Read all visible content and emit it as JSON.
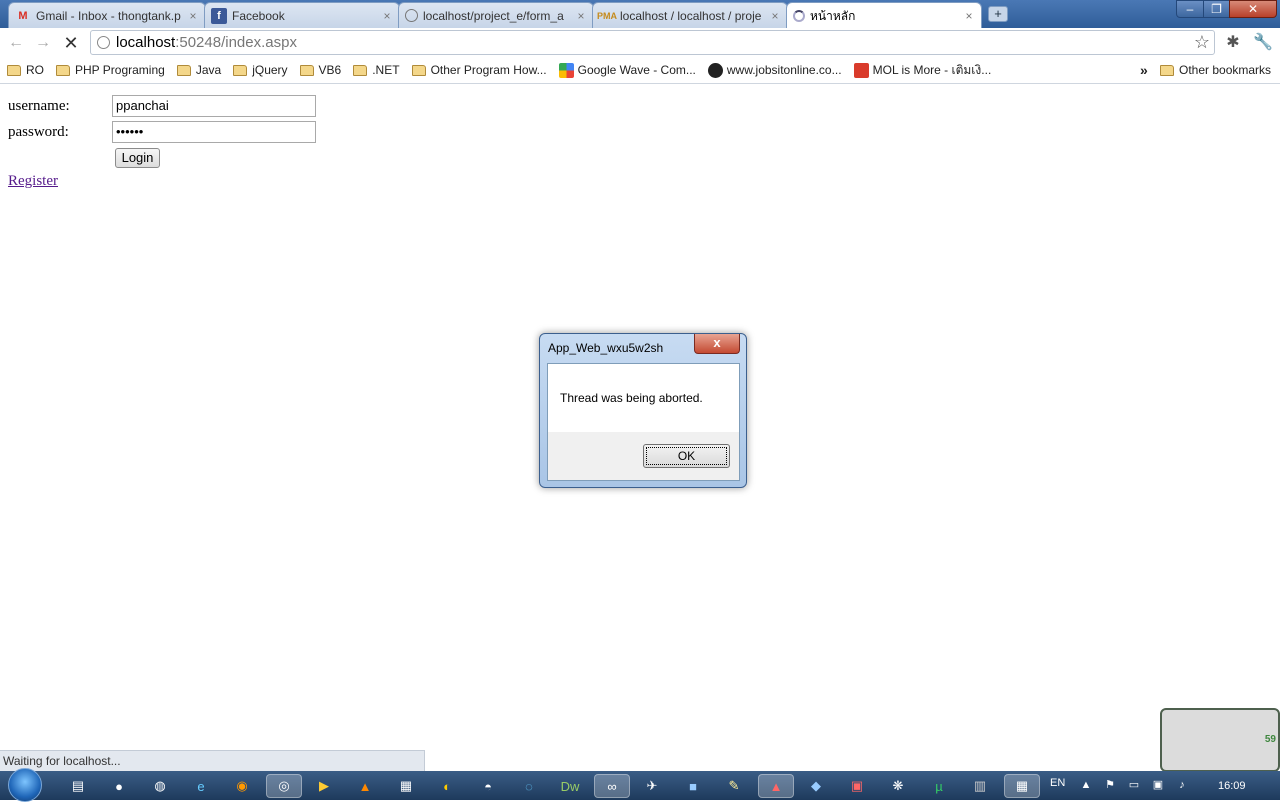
{
  "tabs": [
    {
      "title": "Gmail - Inbox - thongtank.p",
      "icon": "gmail-icon"
    },
    {
      "title": "Facebook",
      "icon": "facebook-icon"
    },
    {
      "title": "localhost/project_e/form_a",
      "icon": "globe-icon"
    },
    {
      "title": "localhost / localhost / proje",
      "icon": "phpmyadmin-icon"
    },
    {
      "title": "หน้าหลัก",
      "icon": "loading-spinner-icon"
    }
  ],
  "address": {
    "host": "localhost",
    "rest": ":50248/index.aspx"
  },
  "bookmarks": [
    {
      "label": "RO",
      "type": "folder"
    },
    {
      "label": "PHP Programing",
      "type": "folder"
    },
    {
      "label": "Java",
      "type": "folder"
    },
    {
      "label": "jQuery",
      "type": "folder"
    },
    {
      "label": "VB6",
      "type": "folder"
    },
    {
      "label": ".NET",
      "type": "folder"
    },
    {
      "label": "Other Program How...",
      "type": "folder"
    },
    {
      "label": "Google Wave - Com...",
      "type": "site"
    },
    {
      "label": "www.jobsitonline.co...",
      "type": "site"
    },
    {
      "label": "MOL is More - เติมเงิ...",
      "type": "site"
    }
  ],
  "bookmarks_more": "»",
  "other_bookmarks": "Other bookmarks",
  "form": {
    "username_label": "username:",
    "username_value": "ppanchai",
    "password_label": "password:",
    "password_value": "••••••",
    "login_label": "Login",
    "register_label": "Register"
  },
  "dialog": {
    "title": "App_Web_wxu5w2sh",
    "message": "Thread was being aborted.",
    "ok_label": "OK",
    "close_glyph": "x"
  },
  "status_text": "Waiting for localhost...",
  "gadget_value": "59",
  "taskbar": {
    "lang": "EN",
    "clock": "16:09"
  },
  "colors": {
    "link_visited": "#551a8b",
    "titlebar": "#4a78b5",
    "taskbar": "#1e3a5c"
  }
}
